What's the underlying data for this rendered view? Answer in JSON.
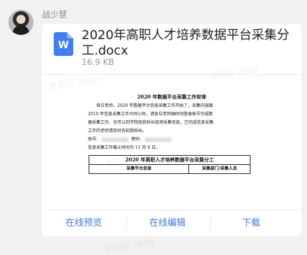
{
  "sender": {
    "name": "战少慧"
  },
  "watermark": {
    "text": "张丽丽 2960"
  },
  "file": {
    "icon_letter": "W",
    "icon_name": "word-doc-icon",
    "name": "2020年高职人才培养数据平台采集分工.docx",
    "size": "16.9 KB"
  },
  "preview": {
    "title": "2020 年数据平台采集工作安排",
    "lines": [
      "各位老师，2020 年数据平台信息采集工作开始了，采集内容跟",
      "2019 年信息采集工作大同小异，请各位老师抽时间登录账号完成数",
      "据采集工作，也可以到学院找我科长现场采集信息，已完成信息采集",
      "工作的老师请及时告知我科长。"
    ],
    "account_label": "账号：",
    "password_label": "密码：",
    "deadline": "信息采集工作截止时间为 11 月 6 日。",
    "table": {
      "caption": "2020 年高职人才培养数据平台采集分工",
      "col1": "采集平台目录",
      "col2": "采集部门/采集人员"
    }
  },
  "actions": {
    "preview": "在线预览",
    "edit": "在线编辑",
    "download": "下载"
  },
  "colors": {
    "accent": "#3b78e7",
    "word": "#3d7ff7"
  }
}
